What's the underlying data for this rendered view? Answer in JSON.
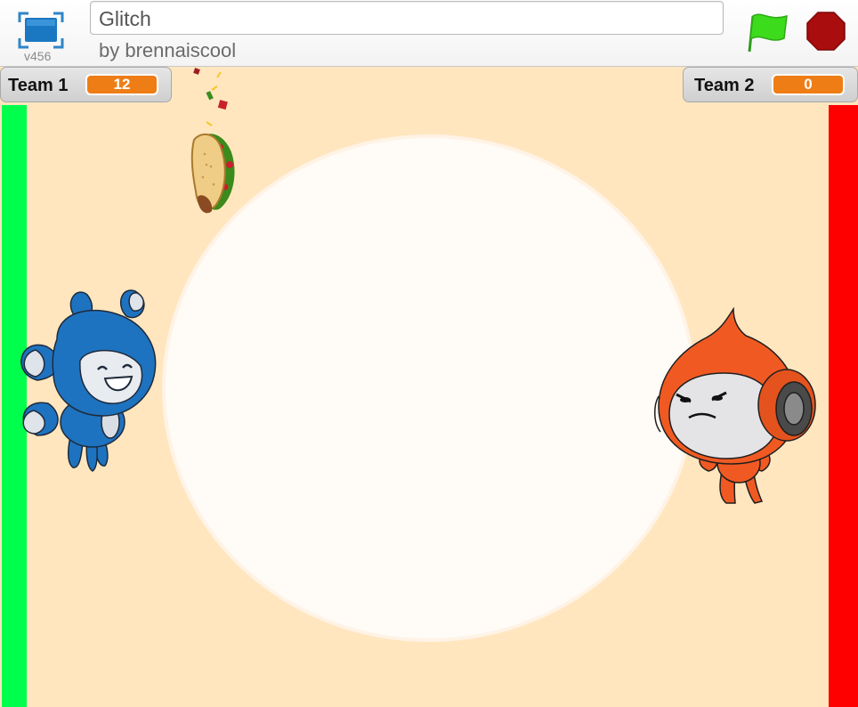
{
  "header": {
    "version": "v456",
    "project_title": "Glitch",
    "author_line": "by brennaiscool",
    "icons": {
      "fullscreen": "fullscreen-icon",
      "green_flag": "green-flag-icon",
      "stop": "stop-sign-icon"
    }
  },
  "stage": {
    "monitors": [
      {
        "label": "Team 1",
        "value": "12"
      },
      {
        "label": "Team 2",
        "value": "0"
      }
    ],
    "colors": {
      "background": "#ffe6bf",
      "arena": "#fffbf6",
      "team1_goal": "#00ff4c",
      "team2_goal": "#ff0000",
      "monitor_value": "#ee7d16",
      "team1_character": "#1e73c0",
      "team2_character": "#f05a22"
    },
    "sprites": [
      "taco-sprite",
      "blue-character-sprite",
      "orange-character-sprite"
    ]
  }
}
